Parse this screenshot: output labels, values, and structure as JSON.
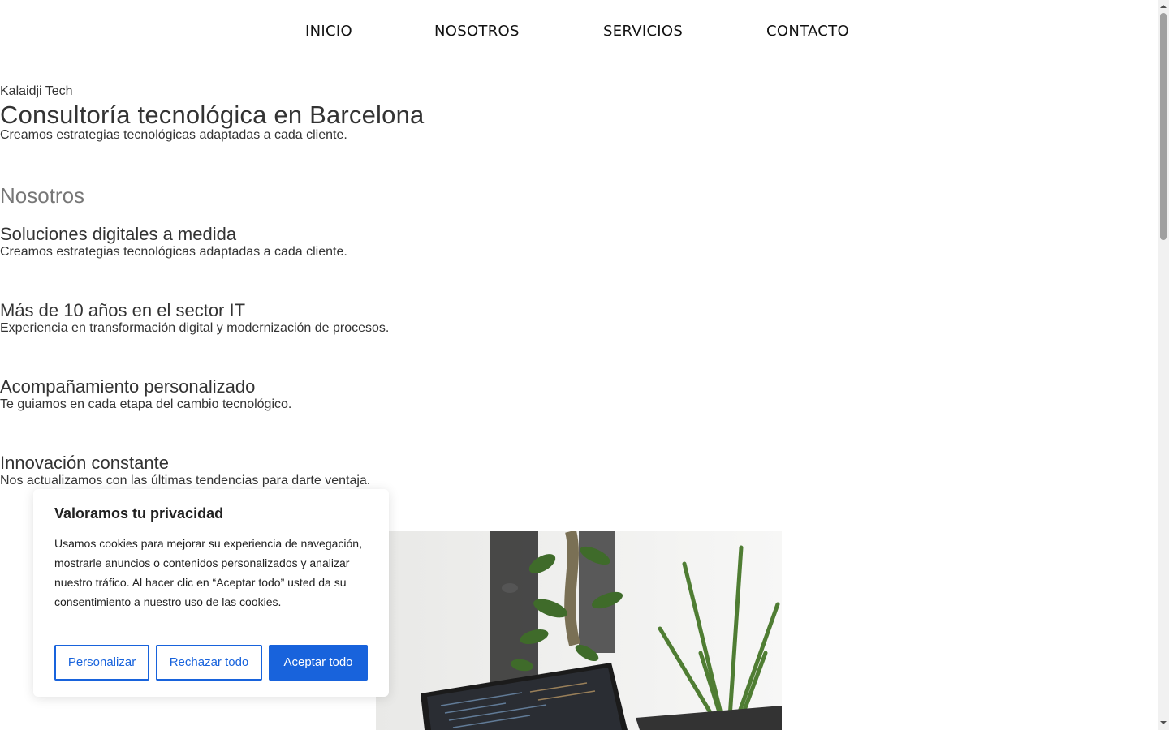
{
  "nav": {
    "items": [
      {
        "label": "INICIO"
      },
      {
        "label": "NOSOTROS"
      },
      {
        "label": "SERVICIOS"
      },
      {
        "label": "CONTACTO"
      }
    ]
  },
  "hero": {
    "kicker": "Kalaidji Tech",
    "title": "Consultoría tecnológica en Barcelona",
    "subtitle": "Creamos estrategias tecnológicas adaptadas a cada cliente."
  },
  "about": {
    "title": "Nosotros",
    "features": [
      {
        "title": "Soluciones digitales a medida",
        "text": "Creamos estrategias tecnológicas adaptadas a cada cliente."
      },
      {
        "title": "Más de 10 años en el sector IT",
        "text": "Experiencia en transformación digital y modernización de procesos."
      },
      {
        "title": "Acompañamiento personalizado",
        "text": "Te guiamos en cada etapa del cambio tecnológico."
      },
      {
        "title": "Innovación constante",
        "text": "Nos actualizamos con las últimas tendencias para darte ventaja."
      }
    ]
  },
  "cookie_banner": {
    "title": "Valoramos tu privacidad",
    "body": "Usamos cookies para mejorar su experiencia de navegación, mostrarle anuncios o contenidos personalizados y analizar nuestro tráfico. Al hacer clic en “Aceptar todo” usted da su consentimiento a nuestro uso de las cookies.",
    "buttons": {
      "customize": "Personalizar",
      "reject": "Rechazar todo",
      "accept": "Aceptar todo"
    },
    "accent_color": "#1863dc"
  },
  "image": {
    "icon": "laptop-plants-photo"
  }
}
